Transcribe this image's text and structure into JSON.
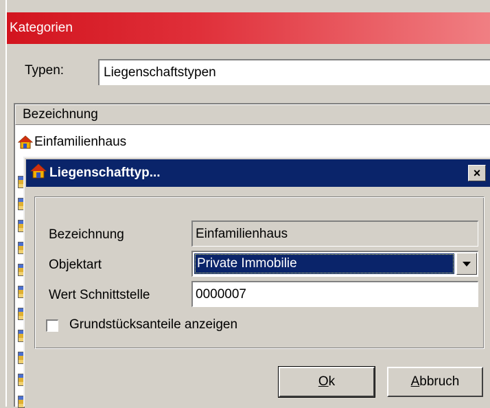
{
  "window": {
    "title": "Kategorien",
    "typen_label": "Typen:",
    "typen_value": "Liegenschaftstypen",
    "list_header": "Bezeichnung",
    "list_items": [
      "Einfamilienhaus"
    ]
  },
  "dialog": {
    "title": "Liegenschafttyp...",
    "close_label": "×",
    "bezeichnung_label": "Bezeichnung",
    "bezeichnung_value": "Einfamilienhaus",
    "objektart_label": "Objektart",
    "objektart_value": "Private Immobilie",
    "wert_label": "Wert Schnittstelle",
    "wert_value": "0000007",
    "checkbox_label": "Grundstücksanteile anzeigen",
    "checkbox_checked": false,
    "ok_mnemonic": "O",
    "ok_rest": "k",
    "cancel_mnemonic": "A",
    "cancel_rest": "bbruch"
  },
  "icons": {
    "row_icon": "house-icon",
    "dialog_icon": "house-icon"
  },
  "colors": {
    "title_red": "#d2141e",
    "dialog_title": "#0a246a",
    "face": "#d4d0c8"
  }
}
